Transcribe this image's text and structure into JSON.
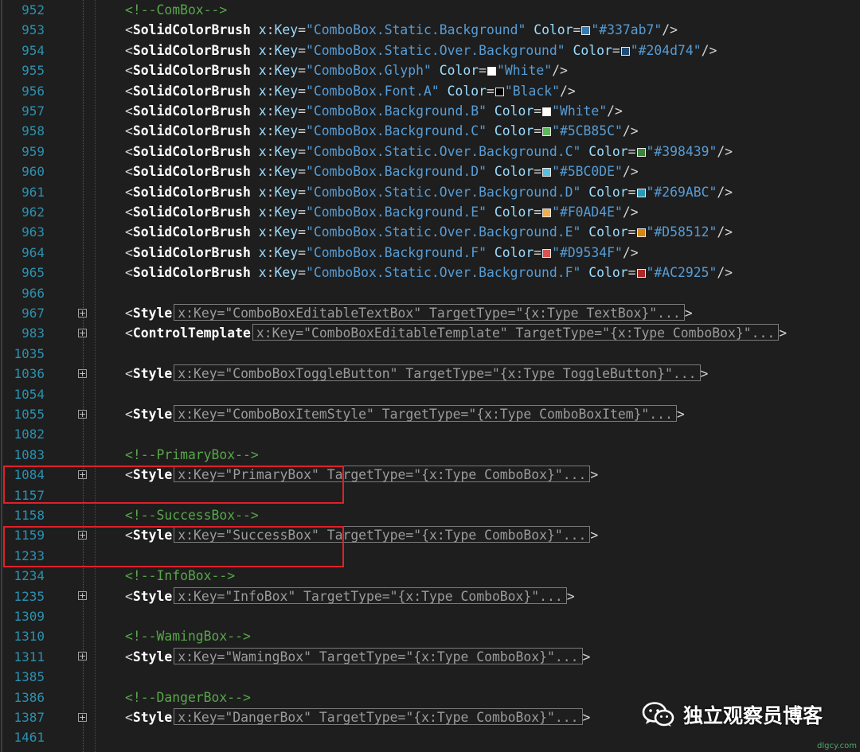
{
  "lines": [
    {
      "n": "952",
      "tokens": [
        {
          "t": "<!--ComBox-->",
          "k": "c"
        }
      ]
    },
    {
      "n": "953",
      "tokens": [
        {
          "t": "<",
          "k": "b"
        },
        {
          "t": "SolidColorBrush",
          "k": "e"
        },
        {
          "t": " x",
          "k": "a"
        },
        {
          "t": ":",
          "k": "b"
        },
        {
          "t": "Key",
          "k": "a"
        },
        {
          "t": "=",
          "k": "b"
        },
        {
          "t": "\"ComboBox.Static.Background\"",
          "k": "s"
        },
        {
          "t": " Color",
          "k": "a"
        },
        {
          "t": "=",
          "k": "b"
        },
        {
          "sw": "#337ab7"
        },
        {
          "t": "\"#337ab7\"",
          "k": "s"
        },
        {
          "t": "/>",
          "k": "b"
        }
      ]
    },
    {
      "n": "954",
      "tokens": [
        {
          "t": "<",
          "k": "b"
        },
        {
          "t": "SolidColorBrush",
          "k": "e"
        },
        {
          "t": " x",
          "k": "a"
        },
        {
          "t": ":",
          "k": "b"
        },
        {
          "t": "Key",
          "k": "a"
        },
        {
          "t": "=",
          "k": "b"
        },
        {
          "t": "\"ComboBox.Static.Over.Background\"",
          "k": "s"
        },
        {
          "t": " Color",
          "k": "a"
        },
        {
          "t": "=",
          "k": "b"
        },
        {
          "sw": "#204d74"
        },
        {
          "t": "\"#204d74\"",
          "k": "s"
        },
        {
          "t": "/>",
          "k": "b"
        }
      ]
    },
    {
      "n": "955",
      "tokens": [
        {
          "t": "<",
          "k": "b"
        },
        {
          "t": "SolidColorBrush",
          "k": "e"
        },
        {
          "t": " x",
          "k": "a"
        },
        {
          "t": ":",
          "k": "b"
        },
        {
          "t": "Key",
          "k": "a"
        },
        {
          "t": "=",
          "k": "b"
        },
        {
          "t": "\"ComboBox.Glyph\"",
          "k": "s"
        },
        {
          "t": " Color",
          "k": "a"
        },
        {
          "t": "=",
          "k": "b"
        },
        {
          "sw": "#ffffff"
        },
        {
          "t": "\"White\"",
          "k": "s"
        },
        {
          "t": "/>",
          "k": "b"
        }
      ]
    },
    {
      "n": "956",
      "tokens": [
        {
          "t": "<",
          "k": "b"
        },
        {
          "t": "SolidColorBrush",
          "k": "e"
        },
        {
          "t": " x",
          "k": "a"
        },
        {
          "t": ":",
          "k": "b"
        },
        {
          "t": "Key",
          "k": "a"
        },
        {
          "t": "=",
          "k": "b"
        },
        {
          "t": "\"ComboBox.Font.A\"",
          "k": "s"
        },
        {
          "t": " Color",
          "k": "a"
        },
        {
          "t": "=",
          "k": "b"
        },
        {
          "sw": "#000000"
        },
        {
          "t": "\"Black\"",
          "k": "s"
        },
        {
          "t": "/>",
          "k": "b"
        }
      ]
    },
    {
      "n": "957",
      "tokens": [
        {
          "t": "<",
          "k": "b"
        },
        {
          "t": "SolidColorBrush",
          "k": "e"
        },
        {
          "t": " x",
          "k": "a"
        },
        {
          "t": ":",
          "k": "b"
        },
        {
          "t": "Key",
          "k": "a"
        },
        {
          "t": "=",
          "k": "b"
        },
        {
          "t": "\"ComboBox.Background.B\"",
          "k": "s"
        },
        {
          "t": " Color",
          "k": "a"
        },
        {
          "t": "=",
          "k": "b"
        },
        {
          "sw": "#ffffff"
        },
        {
          "t": "\"White\"",
          "k": "s"
        },
        {
          "t": "/>",
          "k": "b"
        }
      ]
    },
    {
      "n": "958",
      "tokens": [
        {
          "t": "<",
          "k": "b"
        },
        {
          "t": "SolidColorBrush",
          "k": "e"
        },
        {
          "t": " x",
          "k": "a"
        },
        {
          "t": ":",
          "k": "b"
        },
        {
          "t": "Key",
          "k": "a"
        },
        {
          "t": "=",
          "k": "b"
        },
        {
          "t": "\"ComboBox.Background.C\"",
          "k": "s"
        },
        {
          "t": " Color",
          "k": "a"
        },
        {
          "t": "=",
          "k": "b"
        },
        {
          "sw": "#5CB85C"
        },
        {
          "t": "\"#5CB85C\"",
          "k": "s"
        },
        {
          "t": "/>",
          "k": "b"
        }
      ]
    },
    {
      "n": "959",
      "tokens": [
        {
          "t": "<",
          "k": "b"
        },
        {
          "t": "SolidColorBrush",
          "k": "e"
        },
        {
          "t": " x",
          "k": "a"
        },
        {
          "t": ":",
          "k": "b"
        },
        {
          "t": "Key",
          "k": "a"
        },
        {
          "t": "=",
          "k": "b"
        },
        {
          "t": "\"ComboBox.Static.Over.Background.C\"",
          "k": "s"
        },
        {
          "t": " Color",
          "k": "a"
        },
        {
          "t": "=",
          "k": "b"
        },
        {
          "sw": "#398439"
        },
        {
          "t": "\"#398439\"",
          "k": "s"
        },
        {
          "t": "/>",
          "k": "b"
        }
      ]
    },
    {
      "n": "960",
      "tokens": [
        {
          "t": "<",
          "k": "b"
        },
        {
          "t": "SolidColorBrush",
          "k": "e"
        },
        {
          "t": " x",
          "k": "a"
        },
        {
          "t": ":",
          "k": "b"
        },
        {
          "t": "Key",
          "k": "a"
        },
        {
          "t": "=",
          "k": "b"
        },
        {
          "t": "\"ComboBox.Background.D\"",
          "k": "s"
        },
        {
          "t": " Color",
          "k": "a"
        },
        {
          "t": "=",
          "k": "b"
        },
        {
          "sw": "#5BC0DE"
        },
        {
          "t": "\"#5BC0DE\"",
          "k": "s"
        },
        {
          "t": "/>",
          "k": "b"
        }
      ]
    },
    {
      "n": "961",
      "tokens": [
        {
          "t": "<",
          "k": "b"
        },
        {
          "t": "SolidColorBrush",
          "k": "e"
        },
        {
          "t": " x",
          "k": "a"
        },
        {
          "t": ":",
          "k": "b"
        },
        {
          "t": "Key",
          "k": "a"
        },
        {
          "t": "=",
          "k": "b"
        },
        {
          "t": "\"ComboBox.Static.Over.Background.D\"",
          "k": "s"
        },
        {
          "t": " Color",
          "k": "a"
        },
        {
          "t": "=",
          "k": "b"
        },
        {
          "sw": "#269ABC"
        },
        {
          "t": "\"#269ABC\"",
          "k": "s"
        },
        {
          "t": "/>",
          "k": "b"
        }
      ]
    },
    {
      "n": "962",
      "tokens": [
        {
          "t": "<",
          "k": "b"
        },
        {
          "t": "SolidColorBrush",
          "k": "e"
        },
        {
          "t": " x",
          "k": "a"
        },
        {
          "t": ":",
          "k": "b"
        },
        {
          "t": "Key",
          "k": "a"
        },
        {
          "t": "=",
          "k": "b"
        },
        {
          "t": "\"ComboBox.Background.E\"",
          "k": "s"
        },
        {
          "t": " Color",
          "k": "a"
        },
        {
          "t": "=",
          "k": "b"
        },
        {
          "sw": "#F0AD4E"
        },
        {
          "t": "\"#F0AD4E\"",
          "k": "s"
        },
        {
          "t": "/>",
          "k": "b"
        }
      ]
    },
    {
      "n": "963",
      "tokens": [
        {
          "t": "<",
          "k": "b"
        },
        {
          "t": "SolidColorBrush",
          "k": "e"
        },
        {
          "t": " x",
          "k": "a"
        },
        {
          "t": ":",
          "k": "b"
        },
        {
          "t": "Key",
          "k": "a"
        },
        {
          "t": "=",
          "k": "b"
        },
        {
          "t": "\"ComboBox.Static.Over.Background.E\"",
          "k": "s"
        },
        {
          "t": " Color",
          "k": "a"
        },
        {
          "t": "=",
          "k": "b"
        },
        {
          "sw": "#D58512"
        },
        {
          "t": "\"#D58512\"",
          "k": "s"
        },
        {
          "t": "/>",
          "k": "b"
        }
      ]
    },
    {
      "n": "964",
      "tokens": [
        {
          "t": "<",
          "k": "b"
        },
        {
          "t": "SolidColorBrush",
          "k": "e"
        },
        {
          "t": " x",
          "k": "a"
        },
        {
          "t": ":",
          "k": "b"
        },
        {
          "t": "Key",
          "k": "a"
        },
        {
          "t": "=",
          "k": "b"
        },
        {
          "t": "\"ComboBox.Background.F\"",
          "k": "s"
        },
        {
          "t": " Color",
          "k": "a"
        },
        {
          "t": "=",
          "k": "b"
        },
        {
          "sw": "#D9534F"
        },
        {
          "t": "\"#D9534F\"",
          "k": "s"
        },
        {
          "t": "/>",
          "k": "b"
        }
      ]
    },
    {
      "n": "965",
      "tokens": [
        {
          "t": "<",
          "k": "b"
        },
        {
          "t": "SolidColorBrush",
          "k": "e"
        },
        {
          "t": " x",
          "k": "a"
        },
        {
          "t": ":",
          "k": "b"
        },
        {
          "t": "Key",
          "k": "a"
        },
        {
          "t": "=",
          "k": "b"
        },
        {
          "t": "\"ComboBox.Static.Over.Background.F\"",
          "k": "s"
        },
        {
          "t": " Color",
          "k": "a"
        },
        {
          "t": "=",
          "k": "b"
        },
        {
          "sw": "#AC2925"
        },
        {
          "t": "\"#AC2925\"",
          "k": "s"
        },
        {
          "t": "/>",
          "k": "b"
        }
      ]
    },
    {
      "n": "966",
      "tokens": []
    },
    {
      "n": "967",
      "fold": true,
      "tokens": [
        {
          "t": "<",
          "k": "b"
        },
        {
          "t": "Style",
          "k": "e"
        },
        {
          "collapsed": "x:Key=\"ComboBoxEditableTextBox\" TargetType=\"{x:Type TextBox}\"..."
        },
        {
          "t": ">",
          "k": "b"
        }
      ]
    },
    {
      "n": "983",
      "fold": true,
      "tokens": [
        {
          "t": "<",
          "k": "b"
        },
        {
          "t": "ControlTemplate",
          "k": "e"
        },
        {
          "collapsed": "x:Key=\"ComboBoxEditableTemplate\" TargetType=\"{x:Type ComboBox}\"..."
        },
        {
          "t": ">",
          "k": "b"
        }
      ]
    },
    {
      "n": "1035",
      "tokens": []
    },
    {
      "n": "1036",
      "fold": true,
      "tokens": [
        {
          "t": "<",
          "k": "b"
        },
        {
          "t": "Style",
          "k": "e"
        },
        {
          "collapsed": "x:Key=\"ComboBoxToggleButton\" TargetType=\"{x:Type ToggleButton}\"..."
        },
        {
          "t": ">",
          "k": "b"
        }
      ]
    },
    {
      "n": "1054",
      "tokens": []
    },
    {
      "n": "1055",
      "fold": true,
      "tokens": [
        {
          "t": "<",
          "k": "b"
        },
        {
          "t": "Style",
          "k": "e"
        },
        {
          "collapsed": "x:Key=\"ComboBoxItemStyle\" TargetType=\"{x:Type ComboBoxItem}\"..."
        },
        {
          "t": ">",
          "k": "b"
        }
      ]
    },
    {
      "n": "1082",
      "tokens": []
    },
    {
      "n": "1083",
      "tokens": [
        {
          "t": "<!--PrimaryBox-->",
          "k": "c"
        }
      ]
    },
    {
      "n": "1084",
      "fold": true,
      "tokens": [
        {
          "t": "<",
          "k": "b"
        },
        {
          "t": "Style",
          "k": "e"
        },
        {
          "collapsed": "x:Key=\"PrimaryBox\" TargetType=\"{x:Type ComboBox}\"..."
        },
        {
          "t": ">",
          "k": "b"
        }
      ]
    },
    {
      "n": "1157",
      "tokens": []
    },
    {
      "n": "1158",
      "tokens": [
        {
          "t": "<!--SuccessBox-->",
          "k": "c"
        }
      ]
    },
    {
      "n": "1159",
      "fold": true,
      "tokens": [
        {
          "t": "<",
          "k": "b"
        },
        {
          "t": "Style",
          "k": "e"
        },
        {
          "collapsed": "x:Key=\"SuccessBox\" TargetType=\"{x:Type ComboBox}\"..."
        },
        {
          "t": ">",
          "k": "b"
        }
      ]
    },
    {
      "n": "1233",
      "tokens": []
    },
    {
      "n": "1234",
      "tokens": [
        {
          "t": "<!--InfoBox-->",
          "k": "c"
        }
      ]
    },
    {
      "n": "1235",
      "fold": true,
      "tokens": [
        {
          "t": "<",
          "k": "b"
        },
        {
          "t": "Style",
          "k": "e"
        },
        {
          "collapsed": "x:Key=\"InfoBox\" TargetType=\"{x:Type ComboBox}\"..."
        },
        {
          "t": ">",
          "k": "b"
        }
      ]
    },
    {
      "n": "1309",
      "tokens": []
    },
    {
      "n": "1310",
      "tokens": [
        {
          "t": "<!--WamingBox-->",
          "k": "c"
        }
      ]
    },
    {
      "n": "1311",
      "fold": true,
      "tokens": [
        {
          "t": "<",
          "k": "b"
        },
        {
          "t": "Style",
          "k": "e"
        },
        {
          "collapsed": "x:Key=\"WamingBox\" TargetType=\"{x:Type ComboBox}\"..."
        },
        {
          "t": ">",
          "k": "b"
        }
      ]
    },
    {
      "n": "1385",
      "tokens": []
    },
    {
      "n": "1386",
      "tokens": [
        {
          "t": "<!--DangerBox-->",
          "k": "c"
        }
      ]
    },
    {
      "n": "1387",
      "fold": true,
      "tokens": [
        {
          "t": "<",
          "k": "b"
        },
        {
          "t": "Style",
          "k": "e"
        },
        {
          "collapsed": "x:Key=\"DangerBox\" TargetType=\"{x:Type ComboBox}\"..."
        },
        {
          "t": ">",
          "k": "b"
        }
      ]
    },
    {
      "n": "1461",
      "tokens": []
    }
  ],
  "watermark": {
    "icon": "wechat-icon",
    "text": "独立观察员博客"
  },
  "site": "dlgcy.com",
  "colors": {
    "highlight_box": "#e0202a",
    "line_number": "#2b91af",
    "comment": "#57a64a",
    "string": "#569cd6"
  }
}
